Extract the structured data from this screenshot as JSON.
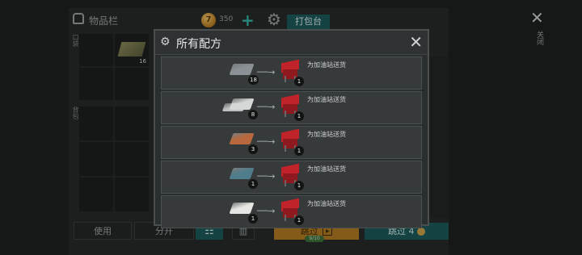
{
  "background": {
    "inventory_title": "物品栏",
    "coin_count": "350",
    "coin_symbol": "7",
    "plus_label": "+",
    "pack_button": "打包台",
    "close_label": "关闭",
    "side_labels": [
      "口袋",
      "背包"
    ],
    "item_slot": {
      "name": "cloth",
      "qty": "16"
    },
    "buttons": {
      "use": "使用",
      "split": "分开",
      "skip_gold": "跳过",
      "skip_progress": "9/10",
      "skip_teal": "跳过 4"
    }
  },
  "modal": {
    "title": "所有配方",
    "recipes": [
      {
        "ingredient": "iron-ingot",
        "color": "#8c9196",
        "qty": "18",
        "result_qty": "1",
        "description": "为加油站送货"
      },
      {
        "ingredient": "aluminum-ingot",
        "color": "#d6d8d8",
        "qty": "8",
        "result_qty": "1",
        "description": "为加油站送货"
      },
      {
        "ingredient": "copper-ingot",
        "color": "#b8683c",
        "qty": "3",
        "result_qty": "1",
        "description": "为加油站送货"
      },
      {
        "ingredient": "steel-ingot",
        "color": "#4f7d8c",
        "qty": "1",
        "result_qty": "1",
        "description": "为加油站送货"
      },
      {
        "ingredient": "silver-ingot",
        "color": "#e6e6e2",
        "qty": "1",
        "result_qty": "1",
        "description": "为加油站送货"
      }
    ]
  }
}
